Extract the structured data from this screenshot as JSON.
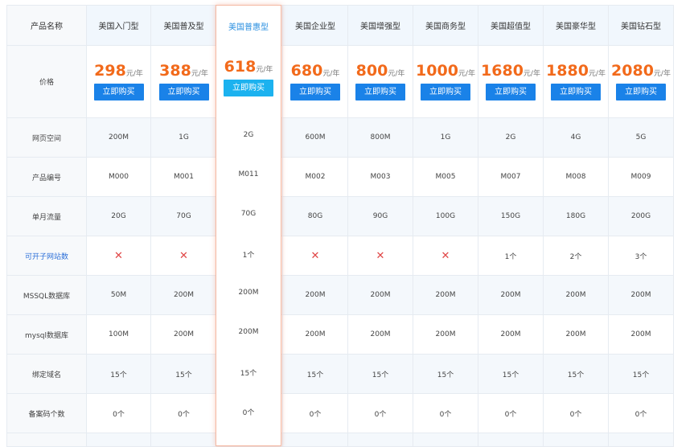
{
  "row_labels": {
    "name": "产品名称",
    "price": "价格",
    "space": "网页空间",
    "code": "产品编号",
    "traffic": "单月流量",
    "sites": "可开子网站数",
    "mssql": "MSSQL数据库",
    "mysql": "mysql数据库",
    "domains": "绑定域名",
    "beian": "备案码个数"
  },
  "unit": "元/年",
  "buy_label": "立即购买",
  "cross_symbol": "✕",
  "plans": [
    {
      "name": "美国入门型",
      "price": "298",
      "space": "200M",
      "code": "M000",
      "traffic": "20G",
      "sites": "",
      "mssql": "50M",
      "mysql": "100M",
      "domains": "15个",
      "beian": "0个"
    },
    {
      "name": "美国普及型",
      "price": "388",
      "space": "1G",
      "code": "M001",
      "traffic": "70G",
      "sites": "",
      "mssql": "200M",
      "mysql": "200M",
      "domains": "15个",
      "beian": "0个"
    },
    {
      "name": "美国普惠型",
      "price": "618",
      "space": "2G",
      "code": "M011",
      "traffic": "70G",
      "sites": "1个",
      "mssql": "200M",
      "mysql": "200M",
      "domains": "15个",
      "beian": "0个"
    },
    {
      "name": "美国企业型",
      "price": "680",
      "space": "600M",
      "code": "M002",
      "traffic": "80G",
      "sites": "",
      "mssql": "200M",
      "mysql": "200M",
      "domains": "15个",
      "beian": "0个"
    },
    {
      "name": "美国增强型",
      "price": "800",
      "space": "800M",
      "code": "M003",
      "traffic": "90G",
      "sites": "",
      "mssql": "200M",
      "mysql": "200M",
      "domains": "15个",
      "beian": "0个"
    },
    {
      "name": "美国商务型",
      "price": "1000",
      "space": "1G",
      "code": "M005",
      "traffic": "100G",
      "sites": "",
      "mssql": "200M",
      "mysql": "200M",
      "domains": "15个",
      "beian": "0个"
    },
    {
      "name": "美国超值型",
      "price": "1680",
      "space": "2G",
      "code": "M007",
      "traffic": "150G",
      "sites": "1个",
      "mssql": "200M",
      "mysql": "200M",
      "domains": "15个",
      "beian": "0个"
    },
    {
      "name": "美国豪华型",
      "price": "1880",
      "space": "4G",
      "code": "M008",
      "traffic": "180G",
      "sites": "2个",
      "mssql": "200M",
      "mysql": "200M",
      "domains": "15个",
      "beian": "0个"
    },
    {
      "name": "美国钻石型",
      "price": "2080",
      "space": "5G",
      "code": "M009",
      "traffic": "200G",
      "sites": "3个",
      "mssql": "200M",
      "mysql": "200M",
      "domains": "15个",
      "beian": "0个"
    }
  ]
}
